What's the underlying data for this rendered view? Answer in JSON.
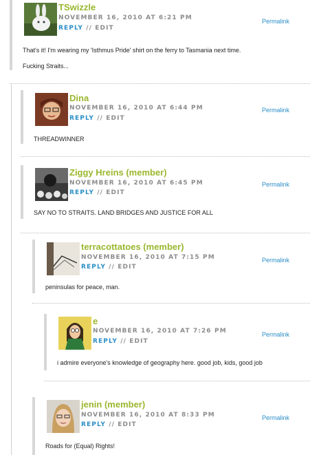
{
  "comments": [
    {
      "author": "TSwizzle",
      "timestamp": "NOVEMBER 16, 2010 AT 6:21 PM",
      "reply": "REPLY",
      "sep": "//",
      "edit": "EDIT",
      "permalink": "Permalink",
      "body": [
        "That's it! I'm wearing my 'Isthmus Pride' shirt on the ferry to Tasmania next time.",
        "Fucking Straits..."
      ],
      "avatar_icon": "white-rabbit-avatar"
    },
    {
      "author": "Dina",
      "timestamp": "NOVEMBER 16, 2010 AT 6:44 PM",
      "reply": "REPLY",
      "sep": "//",
      "edit": "EDIT",
      "permalink": "Permalink",
      "body": [
        "THREADWINNER"
      ],
      "avatar_icon": "woman-portrait-avatar"
    },
    {
      "author": "Ziggy Hreins (member)",
      "timestamp": "NOVEMBER 16, 2010 AT 6:45 PM",
      "reply": "REPLY",
      "sep": "//",
      "edit": "EDIT",
      "permalink": "Permalink",
      "body": [
        "SAY NO TO STRAITS. LAND BRIDGES AND JUSTICE FOR ALL"
      ],
      "avatar_icon": "dark-photo-avatar"
    },
    {
      "author": "terracottatoes (member)",
      "timestamp": "NOVEMBER 16, 2010 AT 7:15 PM",
      "reply": "REPLY",
      "sep": "//",
      "edit": "EDIT",
      "permalink": "Permalink",
      "body": [
        "peninsulas for peace, man."
      ],
      "avatar_icon": "sketch-avatar"
    },
    {
      "author": "e",
      "timestamp": "NOVEMBER 16, 2010 AT 7:26 PM",
      "reply": "REPLY",
      "sep": "//",
      "edit": "EDIT",
      "permalink": "Permalink",
      "body": [
        "i admire everyone's knowledge of geography here. good job, kids, good job"
      ],
      "avatar_icon": "cartoon-character-avatar"
    },
    {
      "author": "jenin (member)",
      "timestamp": "NOVEMBER 16, 2010 AT 8:33 PM",
      "reply": "REPLY",
      "sep": "//",
      "edit": "EDIT",
      "permalink": "Permalink",
      "body": [
        "Roads for (Equal) Rights!"
      ],
      "avatar_icon": "girl-with-glasses-avatar"
    }
  ],
  "colors": {
    "author": "#9ab72e",
    "link": "#2a8ec7",
    "meta": "#8c8c8c",
    "thread_bar": "#d7d7d7"
  }
}
